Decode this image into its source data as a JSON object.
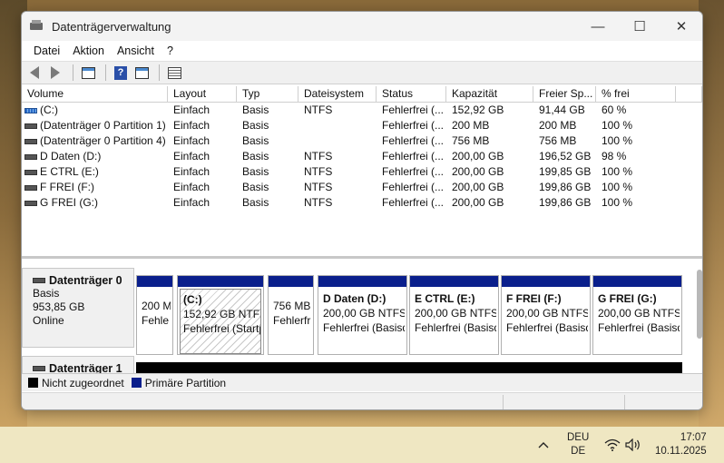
{
  "window": {
    "title": "Datenträgerverwaltung"
  },
  "menu": [
    "Datei",
    "Aktion",
    "Ansicht",
    "?"
  ],
  "volumes": {
    "headers": [
      "Volume",
      "Layout",
      "Typ",
      "Dateisystem",
      "Status",
      "Kapazität",
      "Freier Sp...",
      "% frei"
    ],
    "rows": [
      [
        "(C:)",
        "Einfach",
        "Basis",
        "NTFS",
        "Fehlerfrei (...",
        "152,92 GB",
        "91,44 GB",
        "60 %"
      ],
      [
        "(Datenträger 0 Partition 1)",
        "Einfach",
        "Basis",
        "",
        "Fehlerfrei (...",
        "200 MB",
        "200 MB",
        "100 %"
      ],
      [
        "(Datenträger 0 Partition 4)",
        "Einfach",
        "Basis",
        "",
        "Fehlerfrei (...",
        "756 MB",
        "756 MB",
        "100 %"
      ],
      [
        "D Daten (D:)",
        "Einfach",
        "Basis",
        "NTFS",
        "Fehlerfrei (...",
        "200,00 GB",
        "196,52 GB",
        "98 %"
      ],
      [
        "E CTRL (E:)",
        "Einfach",
        "Basis",
        "NTFS",
        "Fehlerfrei (...",
        "200,00 GB",
        "199,85 GB",
        "100 %"
      ],
      [
        "F FREI (F:)",
        "Einfach",
        "Basis",
        "NTFS",
        "Fehlerfrei (...",
        "200,00 GB",
        "199,86 GB",
        "100 %"
      ],
      [
        "G FREI (G:)",
        "Einfach",
        "Basis",
        "NTFS",
        "Fehlerfrei (...",
        "200,00 GB",
        "199,86 GB",
        "100 %"
      ]
    ]
  },
  "disk0": {
    "title": "Datenträger 0",
    "type": "Basis",
    "size": "953,85 GB",
    "state": "Online",
    "partitions": [
      {
        "name": "",
        "size": "200 M",
        "status": "Fehle"
      },
      {
        "name": "(C:)",
        "size": "152,92 GB NTFS",
        "status": "Fehlerfrei (Startp"
      },
      {
        "name": "",
        "size": "756 MB",
        "status": "Fehlerfr"
      },
      {
        "name": "D Daten  (D:)",
        "size": "200,00 GB NTFS",
        "status": "Fehlerfrei (Basisd"
      },
      {
        "name": "E CTRL  (E:)",
        "size": "200,00 GB NTFS",
        "status": "Fehlerfrei (Basisd"
      },
      {
        "name": "F FREI  (F:)",
        "size": "200,00 GB NTFS",
        "status": "Fehlerfrei (Basisd"
      },
      {
        "name": "G FREI  (G:)",
        "size": "200,00 GB NTFS",
        "status": "Fehlerfrei (Basisd"
      }
    ]
  },
  "disk1": {
    "title": "Datenträger 1"
  },
  "legend": {
    "unallocated": "Nicht zugeordnet",
    "primary": "Primäre Partition"
  },
  "colors": {
    "primary_partition": "#0a1f8c",
    "unallocated": "#000000"
  },
  "taskbar": {
    "lang_top": "DEU",
    "lang_bottom": "DE",
    "time": "17:07",
    "date": "10.11.2025"
  }
}
